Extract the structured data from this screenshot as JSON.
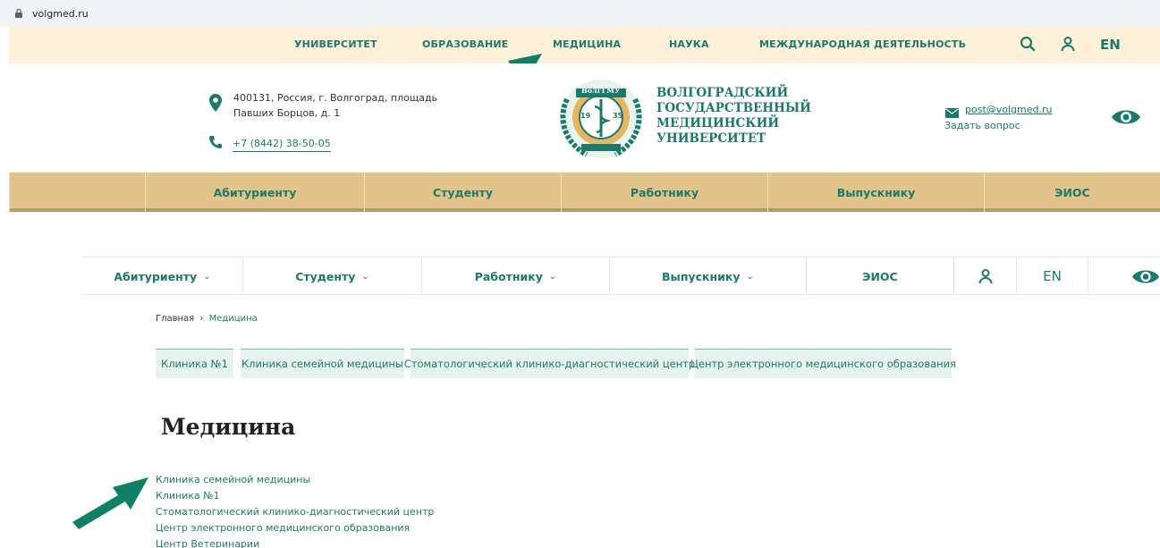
{
  "browser": {
    "url": "volgmed.ru"
  },
  "top_nav": {
    "items": [
      "УНИВЕРСИТЕТ",
      "ОБРАЗОВАНИЕ",
      "МЕДИЦИНА",
      "НАУКА",
      "МЕЖДУНАРОДНАЯ ДЕЯТЕЛЬНОСТЬ"
    ],
    "lang": "EN"
  },
  "header": {
    "address": "400131, Россия, г. Волгоград, площадь Павших Борцов, д. 1",
    "phone": "+7 (8442) 38-50-05",
    "university_name": "ВОЛГОГРАДСКИЙ\nГОСУДАРСТВЕННЫЙ\nМЕДИЦИНСКИЙ\nУНИВЕРСИТЕТ",
    "email": "post@volgmed.ru",
    "ask": "Задать вопрос",
    "logo_text_top": "ВолгГМУ",
    "logo_year_left": "19",
    "logo_year_right": "35"
  },
  "main_nav": {
    "items": [
      "Абитуриенту",
      "Студенту",
      "Работнику",
      "Выпускнику",
      "ЭИОС"
    ]
  },
  "sub_nav": {
    "items": [
      "Абитуриенту",
      "Студенту",
      "Работнику",
      "Выпускнику",
      "ЭИОС"
    ],
    "chevron": "⌄",
    "lang": "EN"
  },
  "breadcrumb": {
    "home": "Главная",
    "separator": "›",
    "current": "Медицина"
  },
  "tabs": [
    "Клиника №1",
    "Клиника семейной медицины",
    "Стоматологический клинико-диагностический центр",
    "Центр электронного медицинского образования"
  ],
  "page_title": "Медицина",
  "links": [
    "Клиника семейной медицины",
    "Клиника №1",
    "Стоматологический клинико-диагностический центр",
    "Центр электронного медицинского образования",
    "Центр Ветеринарии"
  ],
  "colors": {
    "accent": "#1c7a6a",
    "topbar": "#fdf1da",
    "navbar": "#e2c48a",
    "arrow": "#0e8068",
    "tab_bg": "#e7f3ef"
  }
}
